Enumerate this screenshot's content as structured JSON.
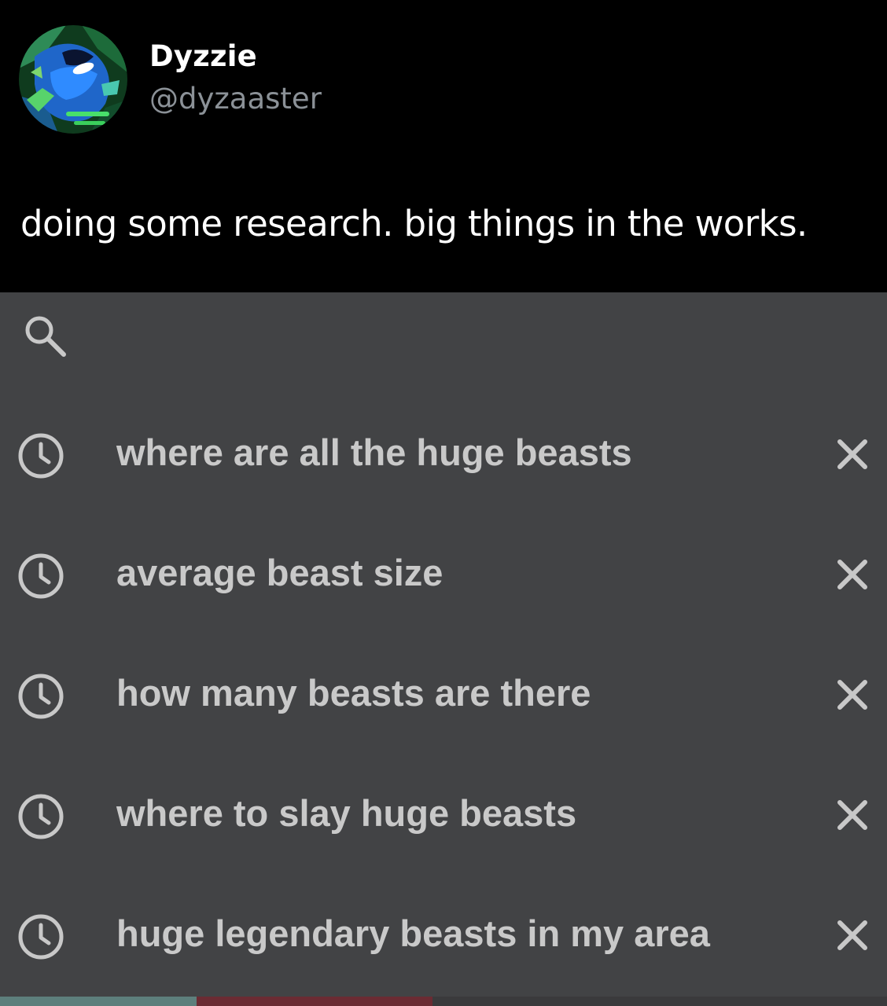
{
  "tweet": {
    "author_name": "Dyzzie",
    "author_handle": "@dyzaaster",
    "text": "doing some research. big things in the works."
  },
  "search": {
    "query_value": "",
    "icon": "search-icon",
    "suggestions": [
      {
        "label": "where are all the huge beasts",
        "icon": "clock-icon",
        "remove_icon": "close-icon"
      },
      {
        "label": "average beast size",
        "icon": "clock-icon",
        "remove_icon": "close-icon"
      },
      {
        "label": "how many beasts are there",
        "icon": "clock-icon",
        "remove_icon": "close-icon"
      },
      {
        "label": "where to slay huge beasts",
        "icon": "clock-icon",
        "remove_icon": "close-icon"
      },
      {
        "label": "huge legendary beasts in my area",
        "icon": "clock-icon",
        "remove_icon": "close-icon"
      }
    ]
  },
  "colors": {
    "tweet_background": "#000000",
    "panel_background": "#424345",
    "suggestion_text": "#c9c9c9",
    "handle_text": "#8b9197"
  }
}
